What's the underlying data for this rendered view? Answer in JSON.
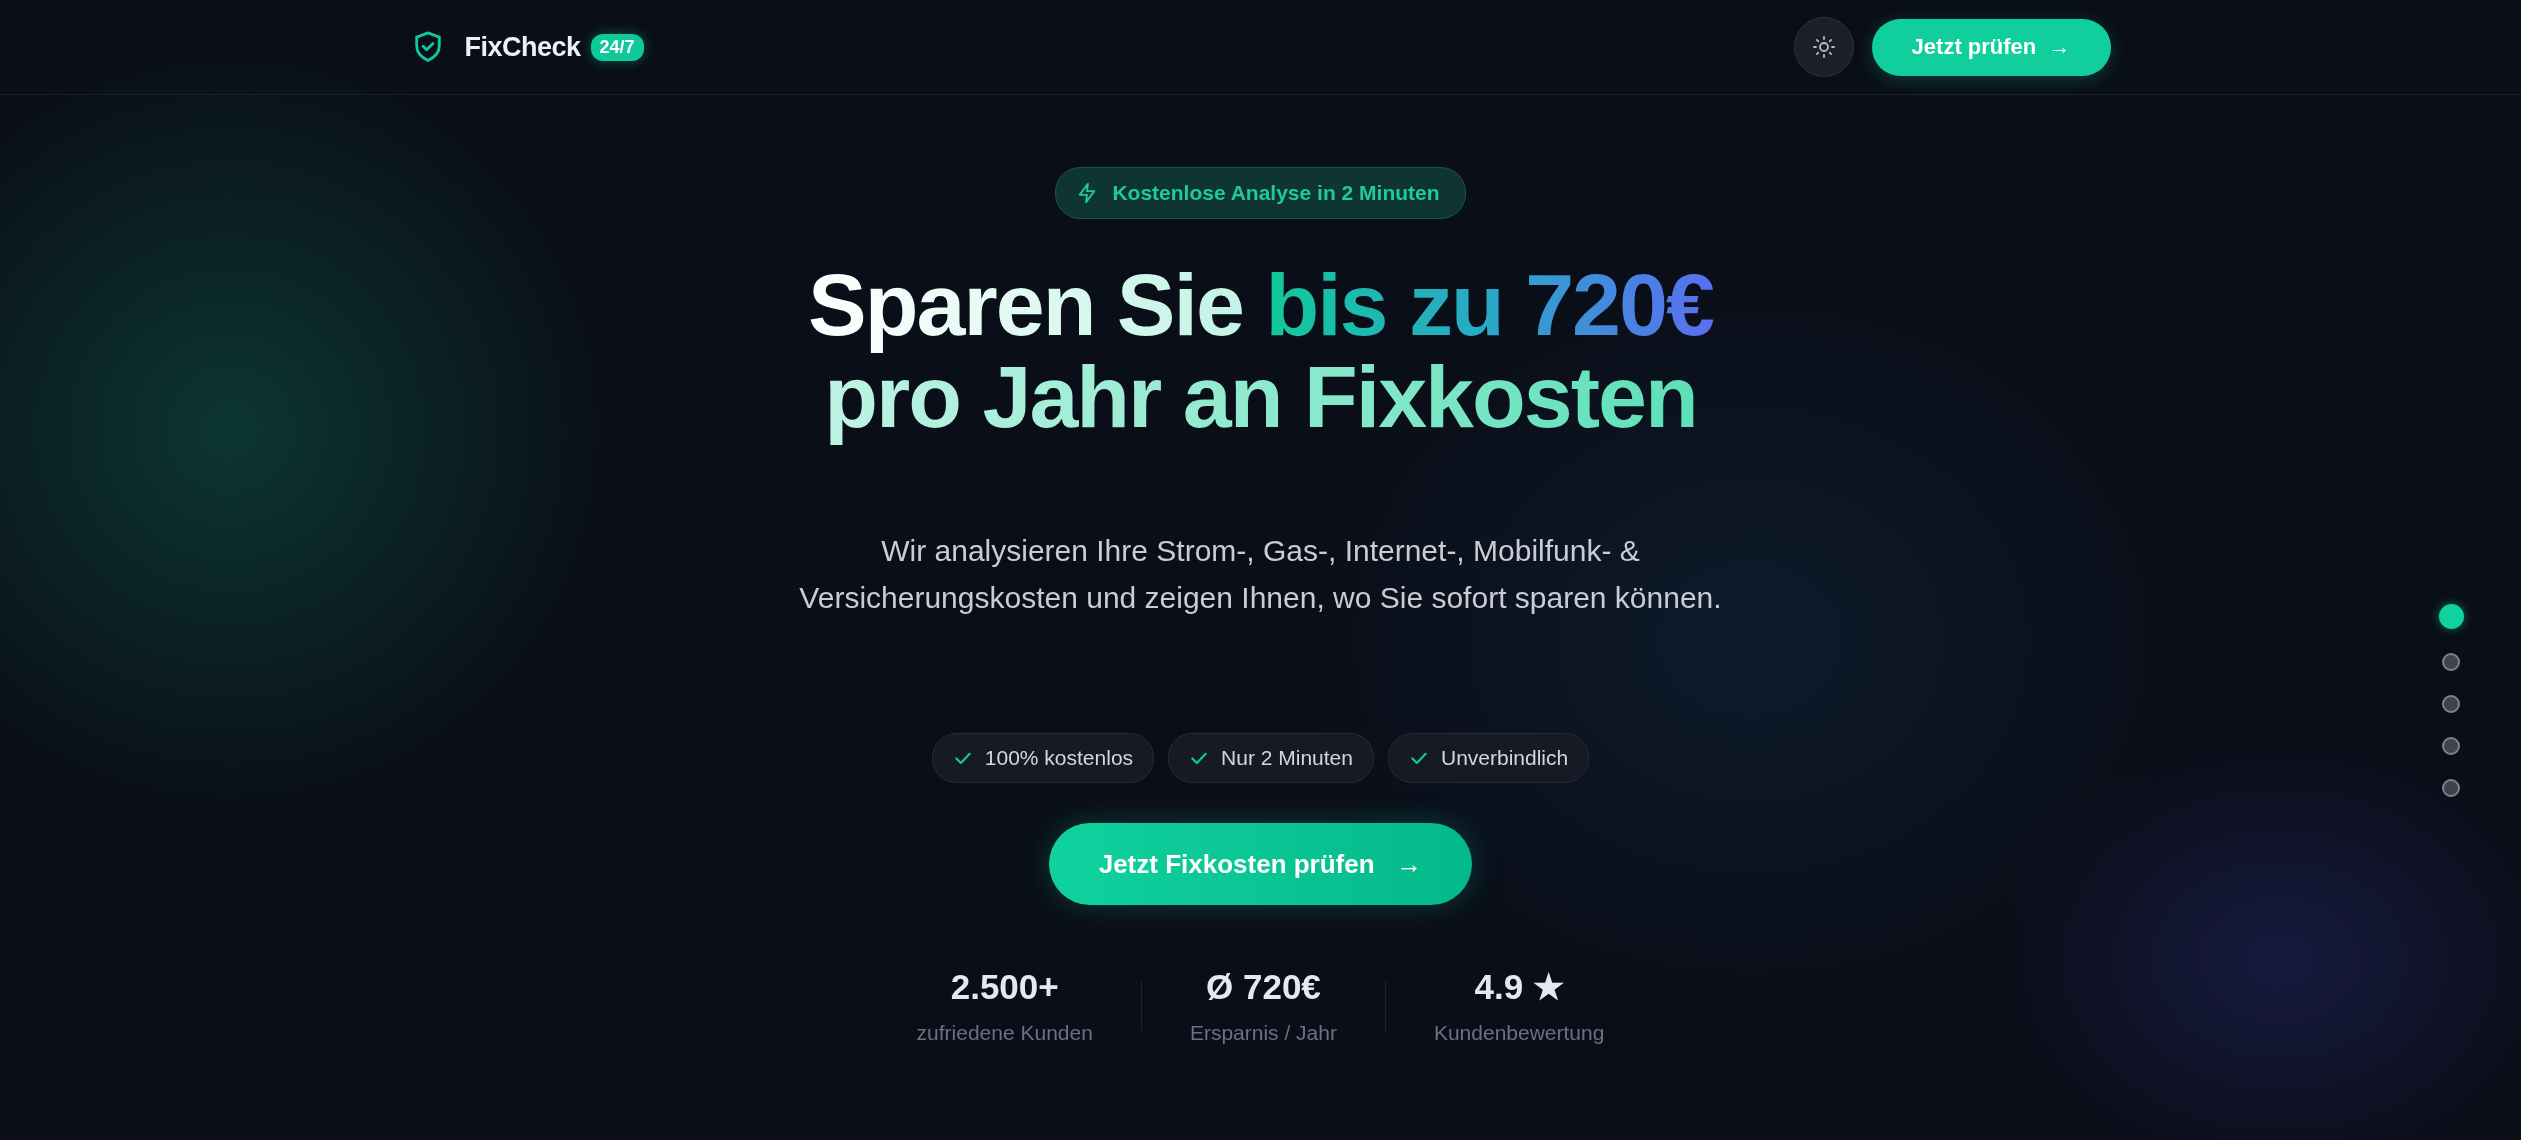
{
  "header": {
    "brand": "FixCheck",
    "brand_badge": "24/7",
    "cta": "Jetzt prüfen",
    "cta_arrow": "→"
  },
  "hero": {
    "badge": "Kostenlose Analyse in 2 Minuten",
    "headline_lines": [
      [
        {
          "text": "Sparen Sie ",
          "kind": "plain"
        },
        {
          "text": "bis zu 720€",
          "kind": "accent"
        }
      ],
      [
        {
          "text": "pro Jahr an Fixkosten",
          "kind": "soft"
        }
      ]
    ],
    "subtitle": "Wir analysieren Ihre Strom-, Gas-, Internet-, Mobilfunk- & Versicherungskosten und zeigen Ihnen, wo Sie sofort sparen können.",
    "features": [
      "100% kostenlos",
      "Nur 2 Minuten",
      "Unverbindlich"
    ],
    "cta": "Jetzt Fixkosten prüfen",
    "cta_arrow": "→",
    "stats": [
      {
        "value": "2.500+",
        "label": "zufriedene Kunden"
      },
      {
        "value": "Ø 720€",
        "label": "Ersparnis / Jahr"
      },
      {
        "value": "4.9 ★",
        "label": "Kundenbewertung"
      }
    ]
  },
  "section_nav": [
    {
      "selected": true
    },
    {
      "selected": false
    },
    {
      "selected": false
    },
    {
      "selected": false
    },
    {
      "selected": false
    }
  ]
}
